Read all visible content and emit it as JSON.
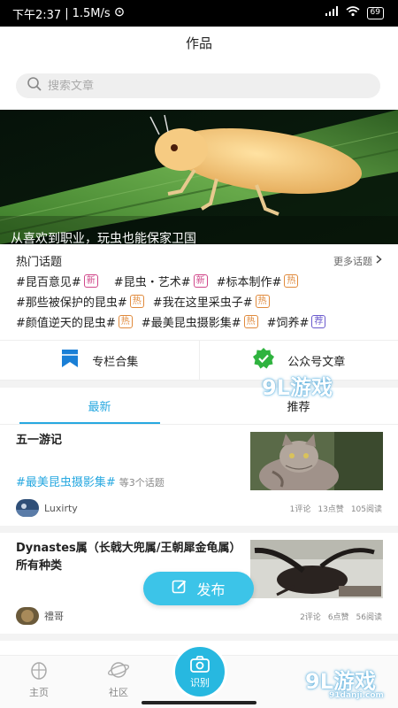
{
  "status_bar": {
    "time": "下午2:37",
    "speed": "1.5M/s",
    "battery": "69"
  },
  "header": {
    "title": "作品"
  },
  "search": {
    "placeholder": "搜索文章"
  },
  "banner": {
    "caption": "从喜欢到职业，玩虫也能保家卫国"
  },
  "hot_topics": {
    "title": "热门话题",
    "more_label": "更多话题",
    "rows": [
      [
        {
          "label": "#昆百意见#",
          "tag": "新",
          "tag_type": "new"
        },
        {
          "label": "#昆虫・艺术#",
          "tag": "新",
          "tag_type": "new"
        },
        {
          "label": "#标本制作#",
          "tag": "热",
          "tag_type": "hot"
        }
      ],
      [
        {
          "label": "#那些被保护的昆虫#",
          "tag": "热",
          "tag_type": "hot"
        },
        {
          "label": "#我在这里采虫子#",
          "tag": "热",
          "tag_type": "hot"
        }
      ],
      [
        {
          "label": "#颜值逆天的昆虫#",
          "tag": "热",
          "tag_type": "hot"
        },
        {
          "label": "#最美昆虫摄影集#",
          "tag": "热",
          "tag_type": "hot"
        },
        {
          "label": "#饲养#",
          "tag": "荐",
          "tag_type": "rec"
        }
      ]
    ]
  },
  "columns": {
    "special_label": "专栏合集",
    "wechat_label": "公众号文章"
  },
  "tabs": {
    "latest": "最新",
    "recommended": "推荐"
  },
  "articles": [
    {
      "title": "五一游记",
      "topic": "#最美昆虫摄影集#",
      "topics_more": "等3个话题",
      "author": "Luxirty",
      "comments": "1评论",
      "likes": "13点赞",
      "reads": "105阅读"
    },
    {
      "title": "Dynastes属（长戟大兜属/王朝犀金龟属）所有种类",
      "topic": "",
      "topics_more": "",
      "author": "禮哥",
      "comments": "2评论",
      "likes": "6点赞",
      "reads": "56阅读"
    }
  ],
  "fab": {
    "label": "发布"
  },
  "bottom_nav": {
    "home": "主页",
    "community": "社区",
    "identify": "识别"
  },
  "watermarks": {
    "top": "9L游戏",
    "bottom": "9L游戏",
    "bottom_url": "91danji.com"
  },
  "colors": {
    "accent": "#27a8e0",
    "fab": "#3cc4e8",
    "tag_new": "#d0478a",
    "tag_hot": "#e08a3c",
    "tag_rec": "#6a5acd"
  }
}
